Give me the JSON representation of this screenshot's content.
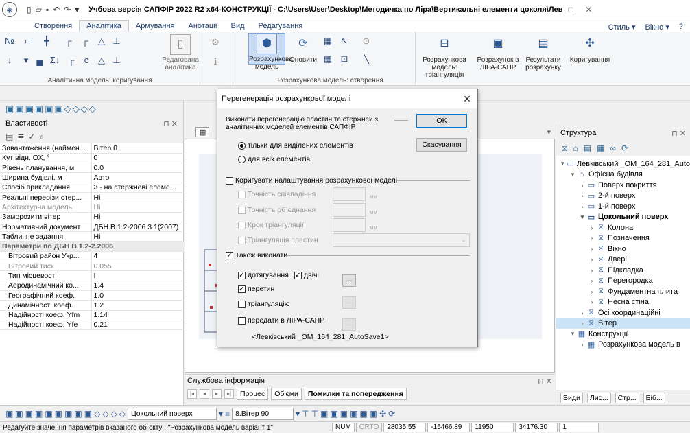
{
  "window": {
    "title": "Учбова версія САПФІР 2022 R2 x64-КОНСТРУКЦІЇ - C:\\Users\\User\\Desktop\\Методичка по Ліра\\Вертикальні елементи цоколя\\Левківськ...",
    "min": "□",
    "close": "✕"
  },
  "ribbon_tabs": [
    "Створення",
    "Аналітика",
    "Армування",
    "Анотації",
    "Вид",
    "Редагування"
  ],
  "ribbon_right": {
    "style": "Стиль",
    "window": "Вікно",
    "help": "?"
  },
  "ribbon": {
    "group1_label": "Аналітична модель: коригування",
    "group2_label": "Розрахункова модель: створення",
    "btn_redag": "Редагована аналітика",
    "btn_rozrah": "Розрахункова модель",
    "btn_onovyty": "Оновити",
    "btn_triang": "Розрахункова модель: тріангуляція",
    "btn_rozrah_v": "Розрахунок в ЛІРА-САПР",
    "btn_results": "Результати розрахунку",
    "btn_koryg": "Коригування"
  },
  "left_panel": {
    "title": "Властивості",
    "rows": [
      {
        "k": "Завантаження (наймен...",
        "v": "Вітер 0"
      },
      {
        "k": "Кут відн. ОХ, °",
        "v": "0"
      },
      {
        "k": "Рівень планування, м",
        "v": "0.0"
      },
      {
        "k": "Ширина будівлі, м",
        "v": "Авто"
      },
      {
        "k": "Спосіб прикладання",
        "v": "3 - на стержневі елеме..."
      },
      {
        "k": "Реальні перерізи стер...",
        "v": "Ні"
      },
      {
        "k": "Архітектурна модель",
        "v": "Ні"
      },
      {
        "k": "Заморозити вітер",
        "v": "Ні"
      },
      {
        "k": "Нормативний документ",
        "v": "ДБН В.1.2-2006 3.1(2007)"
      },
      {
        "k": "Табличне задання",
        "v": "Ні"
      },
      {
        "k": "Параметри по ДБН В.1.2-2.2006",
        "v": ""
      },
      {
        "k": "Вітровий район Укр...",
        "v": "4"
      },
      {
        "k": "Вітровий тиск",
        "v": "0.055"
      },
      {
        "k": "Тип місцевості",
        "v": "I"
      },
      {
        "k": "Аеродинамічний ко...",
        "v": "1.4"
      },
      {
        "k": "Географічний коеф.",
        "v": "1.0"
      },
      {
        "k": "Динамічності коеф.",
        "v": "1.2"
      },
      {
        "k": "Надійності коеф. Yfm",
        "v": "1.14"
      },
      {
        "k": "Надійності коеф. Yfe",
        "v": "0.21"
      }
    ]
  },
  "service": {
    "title": "Службова інформація",
    "tabs": [
      "Процес",
      "Об'єми",
      "Помилки та попередження"
    ]
  },
  "right_panel": {
    "title": "Структура",
    "tree": [
      {
        "label": "Левківський _ОМ_164_281_Auto",
        "level": 0,
        "arrow": "▾",
        "icon": "▭",
        "bold": false
      },
      {
        "label": "Офісна будівля",
        "level": 1,
        "arrow": "▾",
        "icon": "⌂",
        "bold": false
      },
      {
        "label": "Поверх покриття",
        "level": 2,
        "arrow": "›",
        "icon": "▭",
        "bold": false
      },
      {
        "label": "2-й поверх",
        "level": 2,
        "arrow": "›",
        "icon": "▭",
        "bold": false
      },
      {
        "label": "1-й поверх",
        "level": 2,
        "arrow": "›",
        "icon": "▭",
        "bold": false
      },
      {
        "label": "Цокольний поверх",
        "level": 2,
        "arrow": "▾",
        "icon": "▭",
        "bold": true
      },
      {
        "label": "Колона",
        "level": 3,
        "arrow": "›",
        "icon": "⧖",
        "bold": false
      },
      {
        "label": "Позначення",
        "level": 3,
        "arrow": "›",
        "icon": "⧖",
        "bold": false
      },
      {
        "label": "Вікно",
        "level": 3,
        "arrow": "›",
        "icon": "⧖",
        "bold": false
      },
      {
        "label": "Двері",
        "level": 3,
        "arrow": "›",
        "icon": "⧖",
        "bold": false
      },
      {
        "label": "Підкладка",
        "level": 3,
        "arrow": "›",
        "icon": "⧖",
        "bold": false
      },
      {
        "label": "Перегородка",
        "level": 3,
        "arrow": "›",
        "icon": "⧖",
        "bold": false
      },
      {
        "label": "Фундаментна плита",
        "level": 3,
        "arrow": "›",
        "icon": "⧖",
        "bold": false
      },
      {
        "label": "Несна стіна",
        "level": 3,
        "arrow": "›",
        "icon": "⧖",
        "bold": false
      },
      {
        "label": "Осі координаційні",
        "level": 2,
        "arrow": "›",
        "icon": "⧖",
        "bold": false
      },
      {
        "label": "Вітер",
        "level": 2,
        "arrow": "›",
        "icon": "⧖",
        "bold": false,
        "selected": true
      },
      {
        "label": "Конструкції",
        "level": 1,
        "arrow": "▾",
        "icon": "▦",
        "bold": false
      },
      {
        "label": "Розрахункова модель в",
        "level": 2,
        "arrow": "›",
        "icon": "▦",
        "bold": false
      }
    ],
    "bottom_tabs": [
      "Види",
      "Лис...",
      "Стр...",
      "Біб..."
    ]
  },
  "bottom_toolbar": {
    "floor": "Цокольний поверх",
    "load": "8.Вітер 90"
  },
  "status": {
    "message": "Редагуйте значення параметрів вказаного об`єкту : \"Розрахункова модель варіант 1\"",
    "num": "NUM",
    "orto": "ORTO",
    "x": "28035.55",
    "y": "-15466.89",
    "z": "11950",
    "d": "34176.30",
    "n": "1"
  },
  "dialog": {
    "title": "Перегенерація розрахункової моделі",
    "intro": "Виконати перегенерацію пластин та стержней з аналітичних моделей елементів САПФІР",
    "ok": "OK",
    "cancel": "Скасування",
    "radio_selected": "тільки для виділених елементів",
    "radio_all": "для всіх елементів",
    "adjust_label": "Коригувати налаштування розрахункової моделі",
    "precision_match": "Точність співпадіння",
    "precision_join": "Точність об`єднання",
    "tri_step": "Крок тріангуляції",
    "tri_plates": "Тріангуляція пластин",
    "unit": "мм",
    "also_label": "Також виконати",
    "extend": "дотягування",
    "twice": "двічі",
    "intersect": "перетин",
    "triangulate": "тріангуляцію",
    "send": "передати в ЛІРА-САПР",
    "file": "<Левківський _ОМ_164_281_AutoSave1>",
    "ellipsis": "..."
  }
}
